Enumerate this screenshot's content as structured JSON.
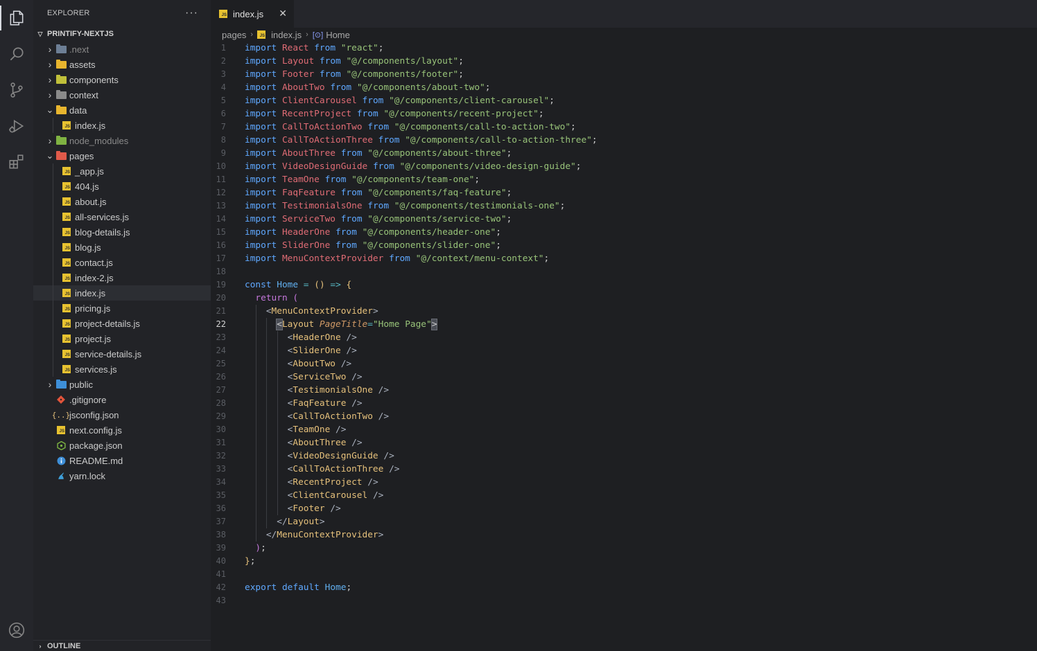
{
  "sidebar": {
    "title": "EXPLORER",
    "more": "···",
    "project": "PRINTIFY-NEXTJS",
    "items": [
      {
        "label": ".next",
        "icon": "folder-icon",
        "color": "#6d7f95",
        "depth": 0,
        "folder": true,
        "open": false,
        "dim": true
      },
      {
        "label": "assets",
        "icon": "folder-icon",
        "color": "#e8b52e",
        "depth": 0,
        "folder": true,
        "open": false
      },
      {
        "label": "components",
        "icon": "folder-icon",
        "color": "#c0c03a",
        "depth": 0,
        "folder": true,
        "open": false
      },
      {
        "label": "context",
        "icon": "folder-icon",
        "color": "#8a8a8a",
        "depth": 0,
        "folder": true,
        "open": false
      },
      {
        "label": "data",
        "icon": "folder-icon",
        "color": "#e8b52e",
        "depth": 0,
        "folder": true,
        "open": true
      },
      {
        "label": "index.js",
        "icon": "js-file-icon",
        "depth": 1,
        "folder": false
      },
      {
        "label": "node_modules",
        "icon": "folder-icon",
        "color": "#7fb242",
        "depth": 0,
        "folder": true,
        "open": false,
        "dim": true
      },
      {
        "label": "pages",
        "icon": "folder-icon",
        "color": "#e05a4a",
        "depth": 0,
        "folder": true,
        "open": true
      },
      {
        "label": "_app.js",
        "icon": "js-file-icon",
        "depth": 1,
        "folder": false
      },
      {
        "label": "404.js",
        "icon": "js-file-icon",
        "depth": 1,
        "folder": false
      },
      {
        "label": "about.js",
        "icon": "js-file-icon",
        "depth": 1,
        "folder": false
      },
      {
        "label": "all-services.js",
        "icon": "js-file-icon",
        "depth": 1,
        "folder": false
      },
      {
        "label": "blog-details.js",
        "icon": "js-file-icon",
        "depth": 1,
        "folder": false
      },
      {
        "label": "blog.js",
        "icon": "js-file-icon",
        "depth": 1,
        "folder": false
      },
      {
        "label": "contact.js",
        "icon": "js-file-icon",
        "depth": 1,
        "folder": false
      },
      {
        "label": "index-2.js",
        "icon": "js-file-icon",
        "depth": 1,
        "folder": false
      },
      {
        "label": "index.js",
        "icon": "js-file-icon",
        "depth": 1,
        "folder": false,
        "selected": true
      },
      {
        "label": "pricing.js",
        "icon": "js-file-icon",
        "depth": 1,
        "folder": false
      },
      {
        "label": "project-details.js",
        "icon": "js-file-icon",
        "depth": 1,
        "folder": false
      },
      {
        "label": "project.js",
        "icon": "js-file-icon",
        "depth": 1,
        "folder": false
      },
      {
        "label": "service-details.js",
        "icon": "js-file-icon",
        "depth": 1,
        "folder": false
      },
      {
        "label": "services.js",
        "icon": "js-file-icon",
        "depth": 1,
        "folder": false
      },
      {
        "label": "public",
        "icon": "folder-icon",
        "color": "#3e8fd8",
        "depth": 0,
        "folder": true,
        "open": false
      },
      {
        "label": ".gitignore",
        "icon": "git-icon",
        "depth": 0,
        "folder": false
      },
      {
        "label": "jsconfig.json",
        "icon": "json-icon",
        "depth": 0,
        "folder": false
      },
      {
        "label": "next.config.js",
        "icon": "js-file-icon",
        "depth": 0,
        "folder": false
      },
      {
        "label": "package.json",
        "icon": "nodejs-icon",
        "depth": 0,
        "folder": false
      },
      {
        "label": "README.md",
        "icon": "info-icon",
        "depth": 0,
        "folder": false
      },
      {
        "label": "yarn.lock",
        "icon": "yarn-icon",
        "depth": 0,
        "folder": false
      }
    ],
    "outline": "OUTLINE"
  },
  "activity": [
    {
      "name": "explorer-icon",
      "active": true
    },
    {
      "name": "search-icon"
    },
    {
      "name": "source-control-icon"
    },
    {
      "name": "run-debug-icon"
    },
    {
      "name": "extensions-icon"
    },
    {
      "name": "account-icon"
    }
  ],
  "editor": {
    "tab": {
      "label": "index.js",
      "close": "✕"
    },
    "breadcrumb": [
      "pages",
      "index.js",
      "Home"
    ],
    "current_line": 22,
    "lines": [
      [
        [
          "kb",
          "import"
        ],
        [
          "pun",
          " "
        ],
        [
          "cls",
          "React"
        ],
        [
          "pun",
          " "
        ],
        [
          "kb",
          "from"
        ],
        [
          "pun",
          " "
        ],
        [
          "str",
          "\"react\""
        ],
        [
          "pun",
          ";"
        ]
      ],
      [
        [
          "kb",
          "import"
        ],
        [
          "pun",
          " "
        ],
        [
          "cls",
          "Layout"
        ],
        [
          "pun",
          " "
        ],
        [
          "kb",
          "from"
        ],
        [
          "pun",
          " "
        ],
        [
          "str",
          "\"@/components/layout\""
        ],
        [
          "pun",
          ";"
        ]
      ],
      [
        [
          "kb",
          "import"
        ],
        [
          "pun",
          " "
        ],
        [
          "cls",
          "Footer"
        ],
        [
          "pun",
          " "
        ],
        [
          "kb",
          "from"
        ],
        [
          "pun",
          " "
        ],
        [
          "str",
          "\"@/components/footer\""
        ],
        [
          "pun",
          ";"
        ]
      ],
      [
        [
          "kb",
          "import"
        ],
        [
          "pun",
          " "
        ],
        [
          "cls",
          "AboutTwo"
        ],
        [
          "pun",
          " "
        ],
        [
          "kb",
          "from"
        ],
        [
          "pun",
          " "
        ],
        [
          "str",
          "\"@/components/about-two\""
        ],
        [
          "pun",
          ";"
        ]
      ],
      [
        [
          "kb",
          "import"
        ],
        [
          "pun",
          " "
        ],
        [
          "cls",
          "ClientCarousel"
        ],
        [
          "pun",
          " "
        ],
        [
          "kb",
          "from"
        ],
        [
          "pun",
          " "
        ],
        [
          "str",
          "\"@/components/client-carousel\""
        ],
        [
          "pun",
          ";"
        ]
      ],
      [
        [
          "kb",
          "import"
        ],
        [
          "pun",
          " "
        ],
        [
          "cls",
          "RecentProject"
        ],
        [
          "pun",
          " "
        ],
        [
          "kb",
          "from"
        ],
        [
          "pun",
          " "
        ],
        [
          "str",
          "\"@/components/recent-project\""
        ],
        [
          "pun",
          ";"
        ]
      ],
      [
        [
          "kb",
          "import"
        ],
        [
          "pun",
          " "
        ],
        [
          "cls",
          "CallToActionTwo"
        ],
        [
          "pun",
          " "
        ],
        [
          "kb",
          "from"
        ],
        [
          "pun",
          " "
        ],
        [
          "str",
          "\"@/components/call-to-action-two\""
        ],
        [
          "pun",
          ";"
        ]
      ],
      [
        [
          "kb",
          "import"
        ],
        [
          "pun",
          " "
        ],
        [
          "cls",
          "CallToActionThree"
        ],
        [
          "pun",
          " "
        ],
        [
          "kb",
          "from"
        ],
        [
          "pun",
          " "
        ],
        [
          "str",
          "\"@/components/call-to-action-three\""
        ],
        [
          "pun",
          ";"
        ]
      ],
      [
        [
          "kb",
          "import"
        ],
        [
          "pun",
          " "
        ],
        [
          "cls",
          "AboutThree"
        ],
        [
          "pun",
          " "
        ],
        [
          "kb",
          "from"
        ],
        [
          "pun",
          " "
        ],
        [
          "str",
          "\"@/components/about-three\""
        ],
        [
          "pun",
          ";"
        ]
      ],
      [
        [
          "kb",
          "import"
        ],
        [
          "pun",
          " "
        ],
        [
          "cls",
          "VideoDesignGuide"
        ],
        [
          "pun",
          " "
        ],
        [
          "kb",
          "from"
        ],
        [
          "pun",
          " "
        ],
        [
          "str",
          "\"@/components/video-design-guide\""
        ],
        [
          "pun",
          ";"
        ]
      ],
      [
        [
          "kb",
          "import"
        ],
        [
          "pun",
          " "
        ],
        [
          "cls",
          "TeamOne"
        ],
        [
          "pun",
          " "
        ],
        [
          "kb",
          "from"
        ],
        [
          "pun",
          " "
        ],
        [
          "str",
          "\"@/components/team-one\""
        ],
        [
          "pun",
          ";"
        ]
      ],
      [
        [
          "kb",
          "import"
        ],
        [
          "pun",
          " "
        ],
        [
          "cls",
          "FaqFeature"
        ],
        [
          "pun",
          " "
        ],
        [
          "kb",
          "from"
        ],
        [
          "pun",
          " "
        ],
        [
          "str",
          "\"@/components/faq-feature\""
        ],
        [
          "pun",
          ";"
        ]
      ],
      [
        [
          "kb",
          "import"
        ],
        [
          "pun",
          " "
        ],
        [
          "cls",
          "TestimonialsOne"
        ],
        [
          "pun",
          " "
        ],
        [
          "kb",
          "from"
        ],
        [
          "pun",
          " "
        ],
        [
          "str",
          "\"@/components/testimonials-one\""
        ],
        [
          "pun",
          ";"
        ]
      ],
      [
        [
          "kb",
          "import"
        ],
        [
          "pun",
          " "
        ],
        [
          "cls",
          "ServiceTwo"
        ],
        [
          "pun",
          " "
        ],
        [
          "kb",
          "from"
        ],
        [
          "pun",
          " "
        ],
        [
          "str",
          "\"@/components/service-two\""
        ],
        [
          "pun",
          ";"
        ]
      ],
      [
        [
          "kb",
          "import"
        ],
        [
          "pun",
          " "
        ],
        [
          "cls",
          "HeaderOne"
        ],
        [
          "pun",
          " "
        ],
        [
          "kb",
          "from"
        ],
        [
          "pun",
          " "
        ],
        [
          "str",
          "\"@/components/header-one\""
        ],
        [
          "pun",
          ";"
        ]
      ],
      [
        [
          "kb",
          "import"
        ],
        [
          "pun",
          " "
        ],
        [
          "cls",
          "SliderOne"
        ],
        [
          "pun",
          " "
        ],
        [
          "kb",
          "from"
        ],
        [
          "pun",
          " "
        ],
        [
          "str",
          "\"@/components/slider-one\""
        ],
        [
          "pun",
          ";"
        ]
      ],
      [
        [
          "kb",
          "import"
        ],
        [
          "pun",
          " "
        ],
        [
          "cls",
          "MenuContextProvider"
        ],
        [
          "pun",
          " "
        ],
        [
          "kb",
          "from"
        ],
        [
          "pun",
          " "
        ],
        [
          "str",
          "\"@/context/menu-context\""
        ],
        [
          "pun",
          ";"
        ]
      ],
      [],
      [
        [
          "kb",
          "const"
        ],
        [
          "pun",
          " "
        ],
        [
          "fn",
          "Home"
        ],
        [
          "pun",
          " "
        ],
        [
          "op",
          "="
        ],
        [
          "pun",
          " "
        ],
        [
          "br1",
          "()"
        ],
        [
          "pun",
          " "
        ],
        [
          "op",
          "=>"
        ],
        [
          "pun",
          " "
        ],
        [
          "br1",
          "{"
        ]
      ],
      [
        [
          "pun",
          "  "
        ],
        [
          "kw",
          "return"
        ],
        [
          "pun",
          " "
        ],
        [
          "br2",
          "("
        ]
      ],
      [
        [
          "pun",
          "    "
        ],
        [
          "tagp",
          "<"
        ],
        [
          "tag",
          "MenuContextProvider"
        ],
        [
          "tagp",
          ">"
        ]
      ],
      [
        [
          "pun",
          "      "
        ],
        [
          "hl",
          "<"
        ],
        [
          "tag",
          "Layout"
        ],
        [
          "pun",
          " "
        ],
        [
          "attr",
          "PageTitle"
        ],
        [
          "op",
          "="
        ],
        [
          "str",
          "\"Home Page\""
        ],
        [
          "hl",
          ">"
        ]
      ],
      [
        [
          "pun",
          "        "
        ],
        [
          "tagp",
          "<"
        ],
        [
          "tag",
          "HeaderOne"
        ],
        [
          "pun",
          " "
        ],
        [
          "tagp",
          "/>"
        ]
      ],
      [
        [
          "pun",
          "        "
        ],
        [
          "tagp",
          "<"
        ],
        [
          "tag",
          "SliderOne"
        ],
        [
          "pun",
          " "
        ],
        [
          "tagp",
          "/>"
        ]
      ],
      [
        [
          "pun",
          "        "
        ],
        [
          "tagp",
          "<"
        ],
        [
          "tag",
          "AboutTwo"
        ],
        [
          "pun",
          " "
        ],
        [
          "tagp",
          "/>"
        ]
      ],
      [
        [
          "pun",
          "        "
        ],
        [
          "tagp",
          "<"
        ],
        [
          "tag",
          "ServiceTwo"
        ],
        [
          "pun",
          " "
        ],
        [
          "tagp",
          "/>"
        ]
      ],
      [
        [
          "pun",
          "        "
        ],
        [
          "tagp",
          "<"
        ],
        [
          "tag",
          "TestimonialsOne"
        ],
        [
          "pun",
          " "
        ],
        [
          "tagp",
          "/>"
        ]
      ],
      [
        [
          "pun",
          "        "
        ],
        [
          "tagp",
          "<"
        ],
        [
          "tag",
          "FaqFeature"
        ],
        [
          "pun",
          " "
        ],
        [
          "tagp",
          "/>"
        ]
      ],
      [
        [
          "pun",
          "        "
        ],
        [
          "tagp",
          "<"
        ],
        [
          "tag",
          "CallToActionTwo"
        ],
        [
          "pun",
          " "
        ],
        [
          "tagp",
          "/>"
        ]
      ],
      [
        [
          "pun",
          "        "
        ],
        [
          "tagp",
          "<"
        ],
        [
          "tag",
          "TeamOne"
        ],
        [
          "pun",
          " "
        ],
        [
          "tagp",
          "/>"
        ]
      ],
      [
        [
          "pun",
          "        "
        ],
        [
          "tagp",
          "<"
        ],
        [
          "tag",
          "AboutThree"
        ],
        [
          "pun",
          " "
        ],
        [
          "tagp",
          "/>"
        ]
      ],
      [
        [
          "pun",
          "        "
        ],
        [
          "tagp",
          "<"
        ],
        [
          "tag",
          "VideoDesignGuide"
        ],
        [
          "pun",
          " "
        ],
        [
          "tagp",
          "/>"
        ]
      ],
      [
        [
          "pun",
          "        "
        ],
        [
          "tagp",
          "<"
        ],
        [
          "tag",
          "CallToActionThree"
        ],
        [
          "pun",
          " "
        ],
        [
          "tagp",
          "/>"
        ]
      ],
      [
        [
          "pun",
          "        "
        ],
        [
          "tagp",
          "<"
        ],
        [
          "tag",
          "RecentProject"
        ],
        [
          "pun",
          " "
        ],
        [
          "tagp",
          "/>"
        ]
      ],
      [
        [
          "pun",
          "        "
        ],
        [
          "tagp",
          "<"
        ],
        [
          "tag",
          "ClientCarousel"
        ],
        [
          "pun",
          " "
        ],
        [
          "tagp",
          "/>"
        ]
      ],
      [
        [
          "pun",
          "        "
        ],
        [
          "tagp",
          "<"
        ],
        [
          "tag",
          "Footer"
        ],
        [
          "pun",
          " "
        ],
        [
          "tagp",
          "/>"
        ]
      ],
      [
        [
          "pun",
          "      "
        ],
        [
          "tagp",
          "</"
        ],
        [
          "tag",
          "Layout"
        ],
        [
          "tagp",
          ">"
        ]
      ],
      [
        [
          "pun",
          "    "
        ],
        [
          "tagp",
          "</"
        ],
        [
          "tag",
          "MenuContextProvider"
        ],
        [
          "tagp",
          ">"
        ]
      ],
      [
        [
          "pun",
          "  "
        ],
        [
          "br2",
          ")"
        ],
        [
          "pun",
          ";"
        ]
      ],
      [
        [
          "br1",
          "}"
        ],
        [
          "pun",
          ";"
        ]
      ],
      [],
      [
        [
          "kb",
          "export"
        ],
        [
          "pun",
          " "
        ],
        [
          "kb",
          "default"
        ],
        [
          "pun",
          " "
        ],
        [
          "fn",
          "Home"
        ],
        [
          "pun",
          ";"
        ]
      ],
      []
    ]
  }
}
